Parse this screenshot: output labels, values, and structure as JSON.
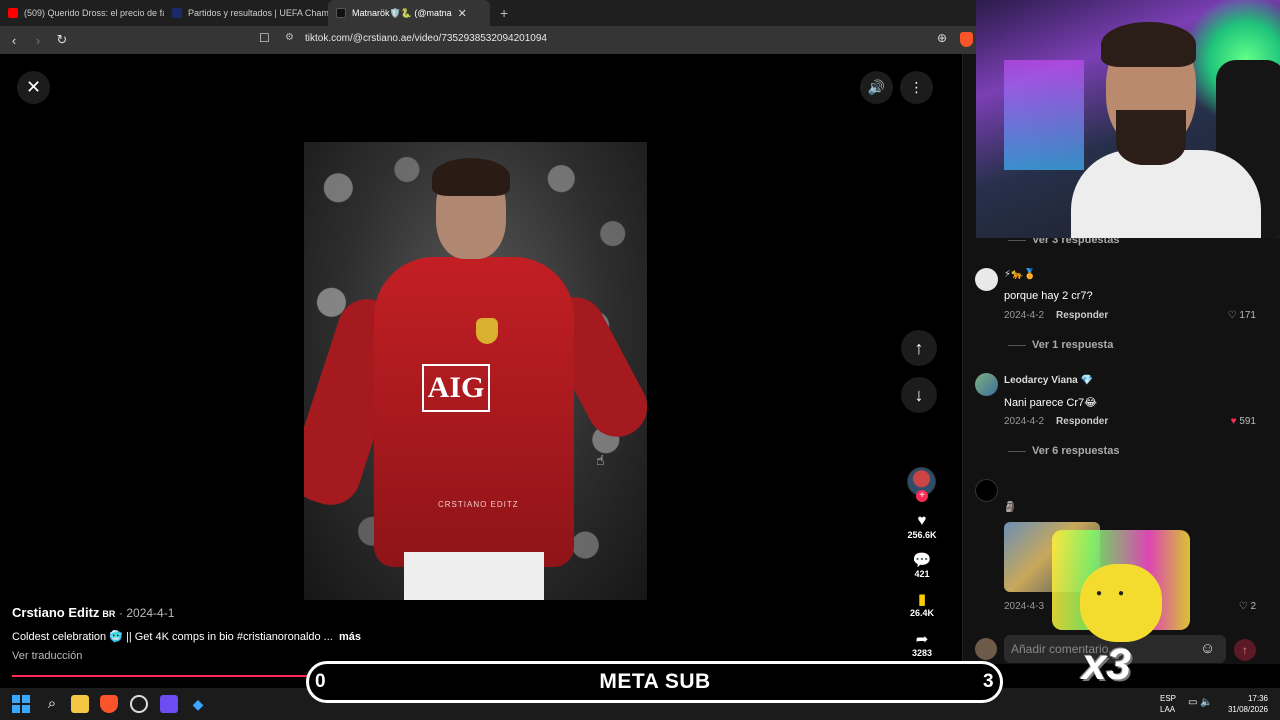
{
  "browser": {
    "tabs": [
      {
        "title": "(509) Querido Dross: el precio de fam",
        "fav_color": "#ff0000"
      },
      {
        "title": "Partidos y resultados | UEFA Champi",
        "fav_color": "#1a2a6c"
      },
      {
        "title": "Matnarök🛡️🐍 (@matna",
        "fav_color": "#111111",
        "active": true
      }
    ],
    "new_tab": "+",
    "url": "tiktok.com/@crstiano.ae/video/7352938532094201094"
  },
  "video": {
    "watermark": "CRSTIANO EDITZ",
    "sponsor": "AIG"
  },
  "actions": {
    "likes": "256.6K",
    "comments": "421",
    "saves": "26.4K",
    "shares": "3283",
    "follow": "+"
  },
  "post": {
    "author": "Crstiano Editz",
    "author_flag": "BR",
    "date": "· 2024-4-1",
    "caption": "Coldest celebration 🥶 || Get 4K comps in bio #cristianoronaldo ...",
    "more": "más",
    "translate": "Ver traducción",
    "progress": 0.86
  },
  "comments_panel": {
    "items": [
      {
        "view_replies": "Ver 3 respuestas"
      },
      {
        "name": "⚡🐆🏅",
        "text": "porque hay 2 cr7?",
        "date": "2024-4-2",
        "reply": "Responder",
        "likes": "171",
        "liked": false,
        "view_replies": "Ver 1 respuesta"
      },
      {
        "name": "Leodarcy Viana 💎",
        "text": "Nani parece Cr7😂",
        "date": "2024-4-2",
        "reply": "Responder",
        "likes": "591",
        "liked": true,
        "view_replies": "Ver 6 respuestas"
      },
      {
        "name": "🗿",
        "text": "",
        "date": "2024-4-3",
        "reply": "",
        "likes": "2",
        "liked": false
      }
    ],
    "input_placeholder": "Añadir comentario...",
    "emoji": "☺",
    "post": "↑"
  },
  "overlay": {
    "meta_left": "0",
    "meta_title": "META SUB",
    "meta_right": "3",
    "multiplier": "x3"
  },
  "taskbar": {
    "lang_line1": "ESP",
    "lang_line2": "LAA",
    "time": "17:36",
    "date": "31/08/2026"
  }
}
